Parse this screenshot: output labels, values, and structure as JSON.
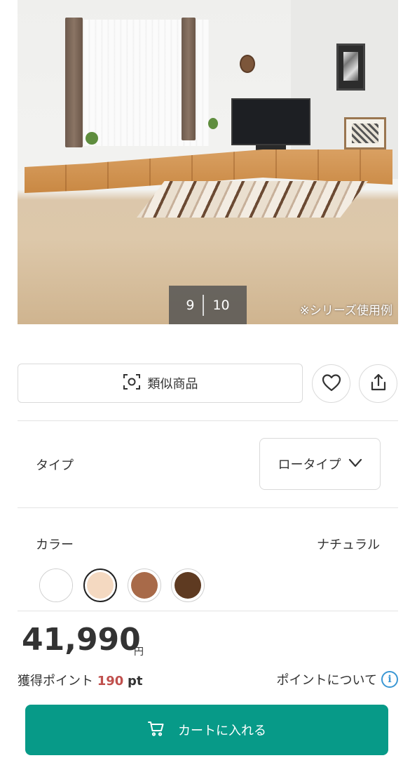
{
  "gallery": {
    "current": "9",
    "total": "10",
    "caption": "※シリーズ使用例"
  },
  "actions": {
    "similar_label": "類似商品"
  },
  "type": {
    "label": "タイプ",
    "selected": "ロータイプ"
  },
  "color": {
    "label": "カラー",
    "selected": "ナチュラル",
    "swatches": [
      "#ffffff",
      "#f4d9c1",
      "#a86a49",
      "#5e3a21"
    ]
  },
  "price": {
    "amount": "41,990",
    "currency": "円"
  },
  "points": {
    "label": "獲得ポイント",
    "value": "190",
    "unit": "pt",
    "about_link": "ポイントについて"
  },
  "cart": {
    "label": "カートに入れる"
  },
  "colors": {
    "cart_button": "#079a88",
    "points_accent": "#c0504d",
    "info_icon": "#3a97d4"
  }
}
